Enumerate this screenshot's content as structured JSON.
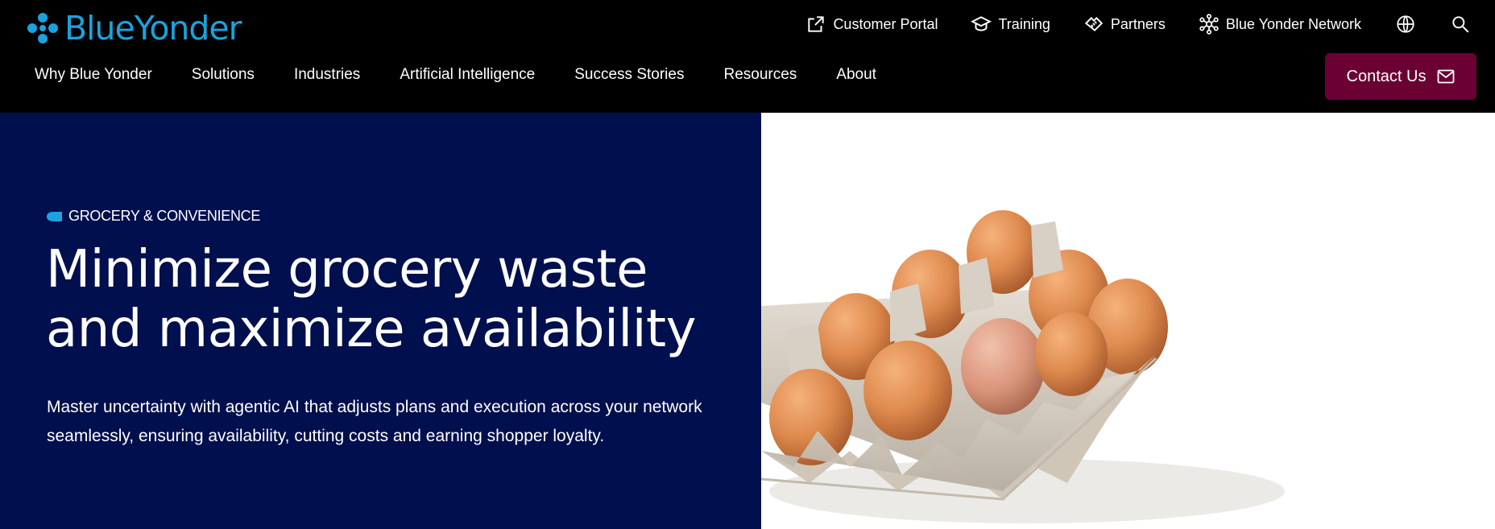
{
  "brand": {
    "name": "BlueYonder",
    "color": "#1aa3de"
  },
  "utility_nav": [
    {
      "label": "Customer Portal",
      "icon": "external-link-icon"
    },
    {
      "label": "Training",
      "icon": "graduation-cap-icon"
    },
    {
      "label": "Partners",
      "icon": "handshake-icon"
    },
    {
      "label": "Blue Yonder Network",
      "icon": "network-icon"
    }
  ],
  "utility_icons": [
    "globe-icon",
    "search-icon"
  ],
  "main_nav": [
    {
      "label": "Why Blue Yonder"
    },
    {
      "label": "Solutions"
    },
    {
      "label": "Industries"
    },
    {
      "label": "Artificial Intelligence"
    },
    {
      "label": "Success Stories"
    },
    {
      "label": "Resources"
    },
    {
      "label": "About"
    }
  ],
  "contact": {
    "label": "Contact Us",
    "icon": "mail-icon",
    "color": "#6b0033"
  },
  "hero": {
    "eyebrow": "GROCERY & CONVENIENCE",
    "title_line1": "Minimize grocery waste",
    "title_line2": "and maximize availability",
    "body_line1": "Master uncertainty with agentic AI that adjusts plans and execution across your network",
    "body_line2": "seamlessly, ensuring availability, cutting costs and earning shopper loyalty.",
    "background_color": "#000f4d",
    "image": "egg-carton-image"
  }
}
